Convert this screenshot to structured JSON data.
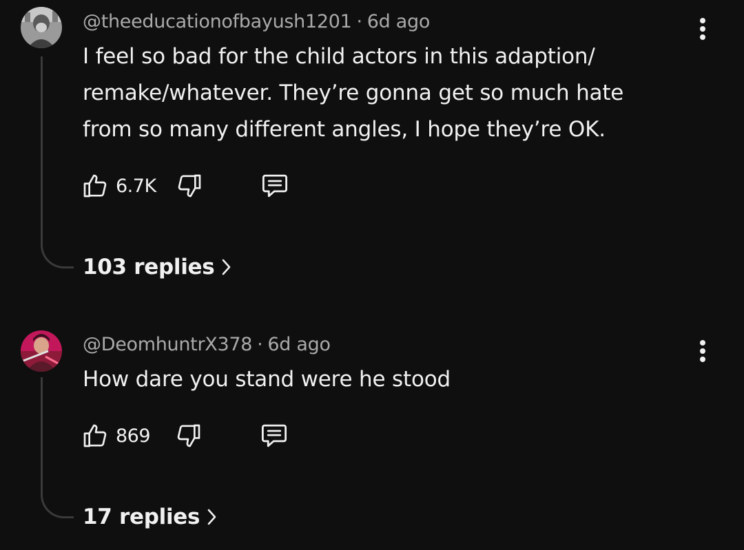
{
  "comments": [
    {
      "handle": "@theeducationofbayush1201",
      "separator": "·",
      "time": "6d ago",
      "text": "I feel so bad for the child actors in this adaption/ remake/whatever. They’re gonna get so much hate from so many different angles, I hope they’re OK.",
      "likes": "6.7K",
      "replies_label": "103 replies",
      "avatar_icon": "avatar-gray-figure",
      "icons": [
        "thumbs-up-icon",
        "thumbs-down-icon",
        "reply-icon",
        "more-vert-icon",
        "chevron-right-icon"
      ]
    },
    {
      "handle": "@DeomhuntrX378",
      "separator": "·",
      "time": "6d ago",
      "text": "How dare you stand were he stood",
      "likes": "869",
      "replies_label": "17 replies",
      "avatar_icon": "avatar-red-character",
      "icons": [
        "thumbs-up-icon",
        "thumbs-down-icon",
        "reply-icon",
        "more-vert-icon",
        "chevron-right-icon"
      ]
    }
  ],
  "colors": {
    "background": "#0f0f0f",
    "text_primary": "#f1f1f1",
    "text_secondary": "#aaaaaa",
    "thread_line": "#3a3a3a"
  }
}
